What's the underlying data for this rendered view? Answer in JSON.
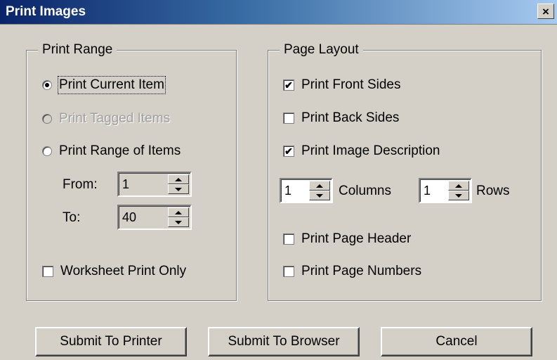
{
  "window": {
    "title": "Print Images",
    "close_glyph": "×"
  },
  "print_range": {
    "legend": "Print Range",
    "current_item_label": "Print Current Item",
    "tagged_items_label": "Print Tagged Items",
    "range_items_label": "Print Range of Items",
    "from_label": "From:",
    "from_value": "1",
    "to_label": "To:",
    "to_value": "40",
    "worksheet_only_label": "Worksheet Print Only",
    "selected": "current"
  },
  "page_layout": {
    "legend": "Page Layout",
    "front_sides_label": "Print Front Sides",
    "front_sides_checked": true,
    "back_sides_label": "Print Back Sides",
    "back_sides_checked": false,
    "image_description_label": "Print Image Description",
    "image_description_checked": true,
    "columns_value": "1",
    "columns_label": "Columns",
    "rows_value": "1",
    "rows_label": "Rows",
    "page_header_label": "Print Page Header",
    "page_header_checked": false,
    "page_numbers_label": "Print Page Numbers",
    "page_numbers_checked": false
  },
  "buttons": {
    "submit_printer": "Submit To Printer",
    "submit_browser": "Submit To Browser",
    "cancel": "Cancel"
  },
  "check_glyph": "✔"
}
